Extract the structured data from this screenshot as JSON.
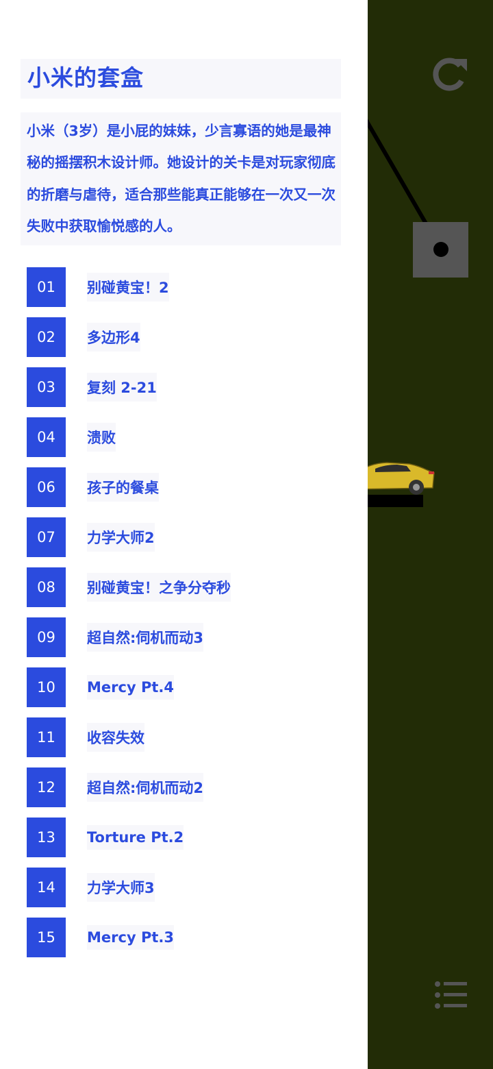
{
  "box": {
    "title": "小米的套盒",
    "description": "小米（3岁）是小屁的妹妹，少言寡语的她是最神秘的摇摆积木设计师。她设计的关卡是对玩家彻底的折磨与虐待，适合那些能真正能够在一次又一次失败中获取愉悦感的人。"
  },
  "levels": [
    {
      "num": "01",
      "name": "别碰黄宝！2"
    },
    {
      "num": "02",
      "name": "多边形4"
    },
    {
      "num": "03",
      "name": "复刻 2-21"
    },
    {
      "num": "04",
      "name": "溃败"
    },
    {
      "num": "06",
      "name": "孩子的餐桌"
    },
    {
      "num": "07",
      "name": "力学大师2"
    },
    {
      "num": "08",
      "name": "别碰黄宝！之争分夺秒"
    },
    {
      "num": "09",
      "name": "超自然:伺机而动3"
    },
    {
      "num": "10",
      "name": "Mercy Pt.4"
    },
    {
      "num": "11",
      "name": "收容失效"
    },
    {
      "num": "12",
      "name": "超自然:伺机而动2"
    },
    {
      "num": "13",
      "name": "Torture Pt.2"
    },
    {
      "num": "14",
      "name": "力学大师3"
    },
    {
      "num": "15",
      "name": "Mercy Pt.3"
    }
  ],
  "colors": {
    "accent": "#2b4bde",
    "drawer_bg": "#ffffff",
    "game_bg": "#222c06",
    "block": "#555555",
    "car": "#d9b92a"
  },
  "icons": {
    "restart": "restart-icon",
    "menu": "level-list-icon"
  }
}
